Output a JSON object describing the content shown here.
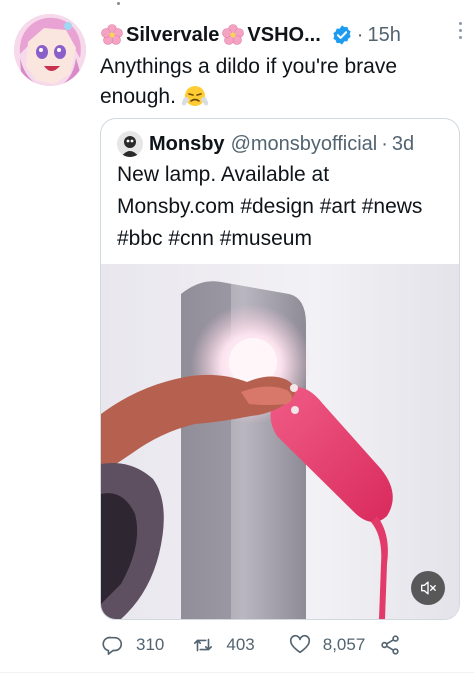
{
  "tweet": {
    "author_name": "Silvervale",
    "author_name_suffix": "VSHO...",
    "separator": "·",
    "time": "15h",
    "text": "Anythings a dildo if you're brave enough."
  },
  "quoted": {
    "name": "Monsby",
    "handle": "@monsbyofficial",
    "separator": "·",
    "time": "3d",
    "text": "New lamp. Available at Monsby.com #design #art #news #bbc #cnn #museum"
  },
  "actions": {
    "replies": "310",
    "retweets": "403",
    "likes": "8,057"
  },
  "icons": {
    "avatar": "anime-avatar-icon",
    "verified": "verified-badge-icon",
    "flower": "cherry-blossom-icon",
    "emoji": "face-with-steam-emoji-icon",
    "mute": "muted-speaker-icon"
  },
  "colors": {
    "verified": "#1d9bf0",
    "muted_text": "#536471",
    "lamp": "#e83a6a",
    "border": "#cfd9de"
  }
}
